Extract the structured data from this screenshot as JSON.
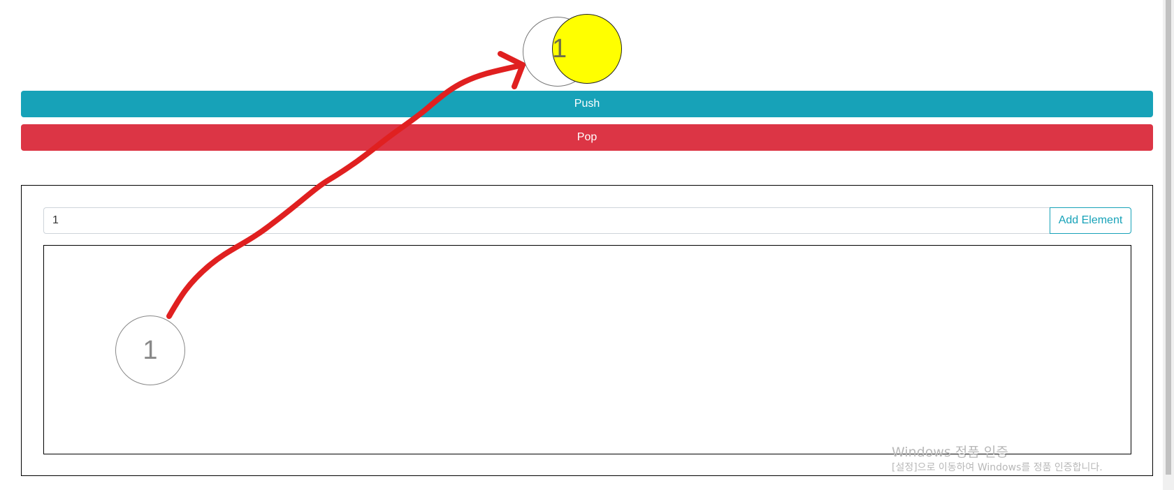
{
  "stack": {
    "top_value": "1"
  },
  "buttons": {
    "push_label": "Push",
    "pop_label": "Pop"
  },
  "input": {
    "value": "1",
    "add_label": "Add Element"
  },
  "canvas": {
    "elements": [
      "1"
    ]
  },
  "watermark": {
    "title": "Windows 정품 인증",
    "subtitle": "[설정]으로 이동하여 Windows를 정품 인증합니다."
  },
  "colors": {
    "push": "#17a2b8",
    "pop": "#dc3545",
    "stack_highlight": "#ffff00",
    "annotation": "#e02020"
  }
}
